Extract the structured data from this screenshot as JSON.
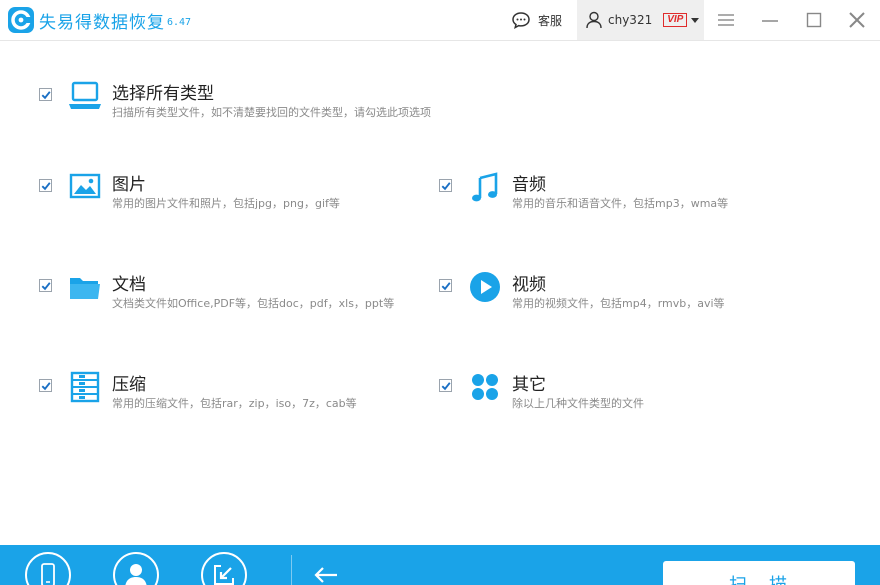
{
  "app": {
    "name": "失易得数据恢复",
    "version": "6.47",
    "support_label": "客服",
    "user_name": "chy321",
    "vip_badge": "VIP"
  },
  "categories": [
    {
      "title": "选择所有类型",
      "desc": "扫描所有类型文件，如不清楚要找回的文件类型，请勾选此项选项",
      "icon": "laptop-icon",
      "checked": true
    },
    {
      "title": "图片",
      "desc": "常用的图片文件和照片，包括jpg，png，gif等",
      "icon": "image-icon",
      "checked": true
    },
    {
      "title": "音频",
      "desc": "常用的音乐和语音文件，包括mp3，wma等",
      "icon": "music-note-icon",
      "checked": true
    },
    {
      "title": "文档",
      "desc": "文档类文件如Office,PDF等，包括doc，pdf，xls，ppt等",
      "icon": "folder-icon",
      "checked": true
    },
    {
      "title": "视频",
      "desc": "常用的视频文件，包括mp4，rmvb，avi等",
      "icon": "play-icon",
      "checked": true
    },
    {
      "title": "压缩",
      "desc": "常用的压缩文件，包括rar，zip，iso，7z，cab等",
      "icon": "archive-icon",
      "checked": true
    },
    {
      "title": "其它",
      "desc": "除以上几种文件类型的文件",
      "icon": "grid-dots-icon",
      "checked": true
    }
  ],
  "bottom": {
    "scan_label": "扫描"
  },
  "colors": {
    "accent": "#1aa3e8",
    "vip": "#e02b2b",
    "desc_text": "#8a8a8a"
  }
}
